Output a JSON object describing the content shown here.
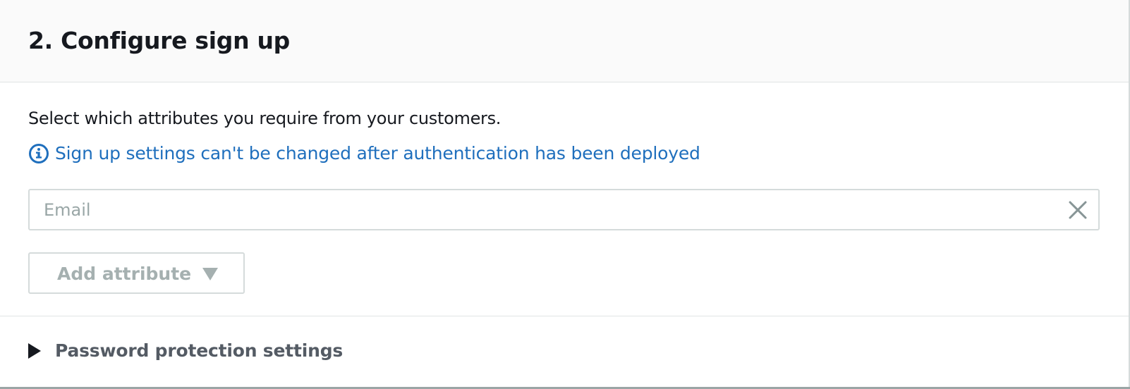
{
  "panel": {
    "title": "2. Configure sign up",
    "description": "Select which attributes you require from your customers.",
    "info_message": "Sign up settings can't be changed after authentication has been deployed",
    "info_icon": "info-circle-icon",
    "attribute_field": {
      "placeholder": "Email",
      "clear_icon": "close-icon"
    },
    "add_attribute_button": {
      "label": "Add attribute",
      "icon": "caret-down-icon",
      "disabled": true
    },
    "expander": {
      "label": "Password protection settings",
      "icon": "caret-right-icon",
      "expanded": false
    }
  },
  "colors": {
    "title_text": "#16191f",
    "info_link": "#1f6fbd",
    "placeholder_text": "#99a6a6",
    "disabled_text": "#a5b0b0",
    "expander_text": "#545b64",
    "header_background": "#fafafa",
    "border": "#d5dbdb"
  }
}
